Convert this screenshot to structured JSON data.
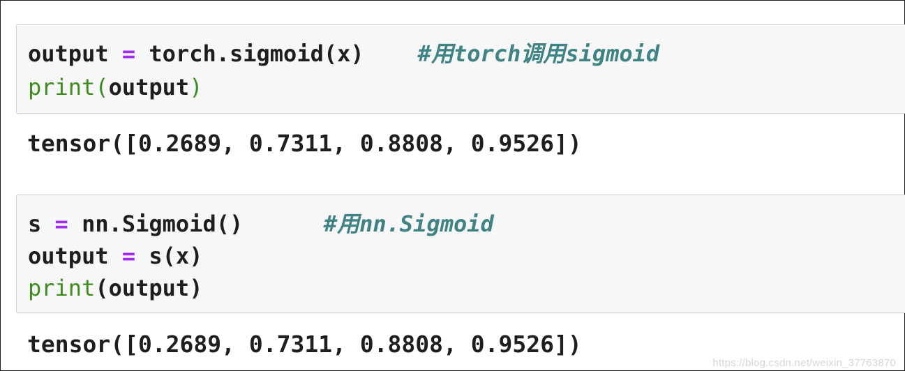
{
  "cells": [
    {
      "lines": [
        {
          "var": "output",
          "eq": "=",
          "expr": "torch.sigmoid(x)",
          "comment": "#用torch调用sigmoid"
        },
        {
          "func": "print",
          "open": "(",
          "arg": "output",
          "close": ")"
        }
      ],
      "output": "tensor([0.2689, 0.7311, 0.8808, 0.9526])"
    },
    {
      "lines": [
        {
          "var": "s",
          "eq": "=",
          "expr": "nn.Sigmoid()",
          "comment": "#用nn.Sigmoid"
        },
        {
          "var": "output",
          "eq": "=",
          "expr": "s(x)"
        },
        {
          "func": "print",
          "arg": "(output)"
        }
      ],
      "output": "tensor([0.2689, 0.7311, 0.8808, 0.9526])"
    }
  ],
  "watermark": "https://blog.csdn.net/weixin_37763870",
  "colors": {
    "operator": "#a22ff0",
    "builtin": "#3c8b1e",
    "comment": "#3f8384",
    "cell_background": "#f7f7f7"
  }
}
